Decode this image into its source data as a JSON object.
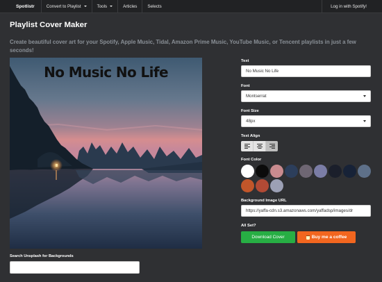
{
  "nav": {
    "brand": "Spotlistr",
    "items": [
      {
        "label": "Convert to Playlist",
        "dropdown": true
      },
      {
        "label": "Tools",
        "dropdown": true
      },
      {
        "label": "Articles",
        "dropdown": false
      },
      {
        "label": "Selects",
        "dropdown": false
      }
    ],
    "login": "Log in with Spotify!"
  },
  "page": {
    "title": "Playlist Cover Maker",
    "subtitle": "Create beautiful cover art for your Spotify, Apple Music, Tidal, Amazon Prime Music, YouTube Music, or Tencent playlists in just a few seconds!"
  },
  "cover": {
    "text": "No Music No Life",
    "font_color": "#111111"
  },
  "unsplash": {
    "label": "Search Unsplash for Backgrounds",
    "value": ""
  },
  "form": {
    "text_label": "Text",
    "text_value": "No Music No Life",
    "font_label": "Font",
    "font_value": "Montserrat",
    "size_label": "Font Size",
    "size_value": "48px",
    "align_label": "Text Align",
    "align_options": [
      "left",
      "center",
      "right"
    ],
    "align_selected": "right",
    "color_label": "Font Color",
    "colors": [
      "#ffffff",
      "#0b0b0b",
      "#c98b8f",
      "#2c3e5b",
      "#6e6673",
      "#7b7da6",
      "#1b1f2b",
      "#172237",
      "#5e7089",
      "#c2562a",
      "#b24a35",
      "#9ca0b5"
    ],
    "image_label": "Background Image URL",
    "image_url": "https://yaffa-cdn.s3.amazonaws.com/yaffadsp/images/dr",
    "allset_label": "All Set?",
    "download_label": "Download Cover",
    "coffee_label": "Buy me a coffee"
  }
}
